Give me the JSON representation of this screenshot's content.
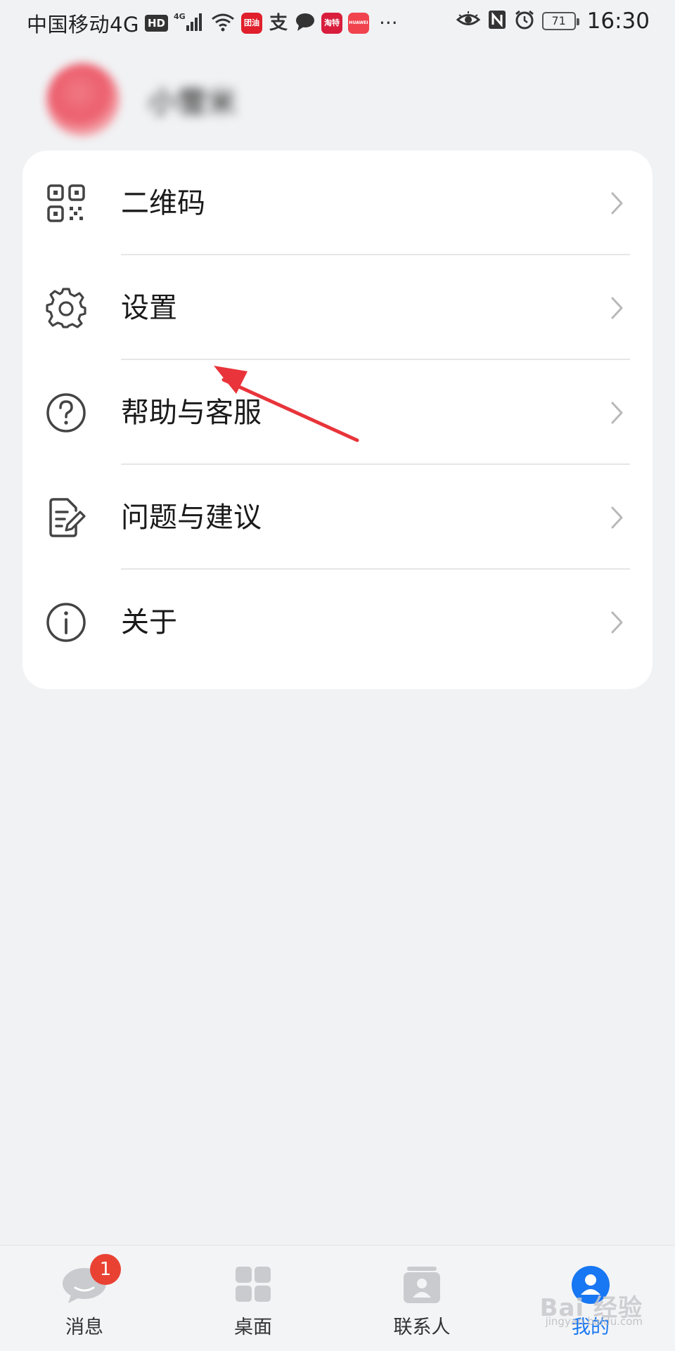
{
  "status_bar": {
    "carrier": "中国移动4G",
    "hd": "HD",
    "network_type": "4G",
    "apps": [
      "团油",
      "支",
      "淘特",
      "HUAWEI"
    ],
    "more": "···",
    "battery": "71",
    "time": "16:30"
  },
  "profile": {
    "name": "小雪米"
  },
  "menu": {
    "items": [
      {
        "label": "二维码",
        "icon": "qr-code-icon"
      },
      {
        "label": "设置",
        "icon": "gear-icon"
      },
      {
        "label": "帮助与客服",
        "icon": "help-icon"
      },
      {
        "label": "问题与建议",
        "icon": "feedback-icon"
      },
      {
        "label": "关于",
        "icon": "info-icon"
      }
    ]
  },
  "annotation": {
    "color": "#e8343a",
    "points_to": "设置"
  },
  "bottom_nav": {
    "tabs": [
      {
        "label": "消息",
        "badge": "1"
      },
      {
        "label": "桌面"
      },
      {
        "label": "联系人"
      },
      {
        "label": "我的",
        "active": true
      }
    ]
  },
  "watermark": {
    "text": "Bai 经验",
    "sub": "jingyan.baidu.com"
  },
  "colors": {
    "accent": "#1877f2",
    "badge": "#e94233",
    "background": "#f1f2f4"
  }
}
